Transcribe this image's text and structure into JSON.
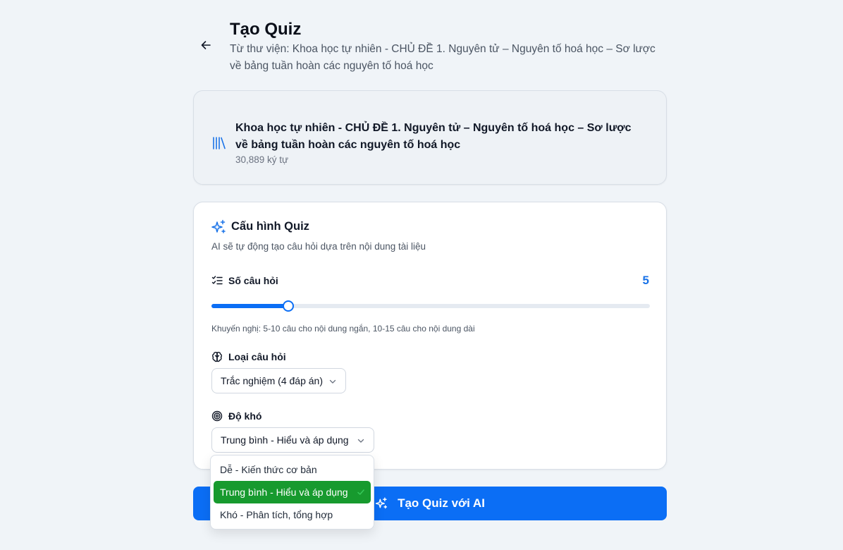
{
  "header": {
    "title": "Tạo Quiz",
    "subtitle": "Từ thư viện: Khoa học tự nhiên - CHỦ ĐỀ 1. Nguyên tử – Nguyên tố hoá học – Sơ lược về bảng tuần hoàn các nguyên tố hoá học"
  },
  "source": {
    "title": "Khoa học tự nhiên - CHỦ ĐỀ 1. Nguyên tử – Nguyên tố hoá học – Sơ lược về bảng tuần hoàn các nguyên tố hoá học",
    "meta": "30,889 ký tự"
  },
  "config": {
    "title": "Cấu hình Quiz",
    "description": "AI sẽ tự động tạo câu hỏi dựa trên nội dung tài liệu",
    "question_count": {
      "label": "Số câu hỏi",
      "value": "5",
      "slider_fraction": 0.175,
      "hint": "Khuyến nghị: 5-10 câu cho nội dung ngắn, 10-15 câu cho nội dung dài"
    },
    "question_type": {
      "label": "Loại câu hỏi",
      "selected": "Trắc nghiệm (4 đáp án)"
    },
    "difficulty": {
      "label": "Độ khó",
      "selected": "Trung bình - Hiểu và áp dụng",
      "options": [
        "Dễ - Kiến thức cơ bản",
        "Trung bình - Hiểu và áp dụng",
        "Khó - Phân tích, tổng hợp"
      ]
    }
  },
  "actions": {
    "generate_label": "Tạo Quiz với AI"
  },
  "colors": {
    "accent": "#0b6ef5",
    "selected_option": "#179a2e",
    "background": "#f0f4f8"
  },
  "icons": [
    "arrow-left-icon",
    "library-icon",
    "sparkles-icon",
    "list-checks-icon",
    "brain-icon",
    "target-icon",
    "chevron-down-icon",
    "check-icon"
  ]
}
